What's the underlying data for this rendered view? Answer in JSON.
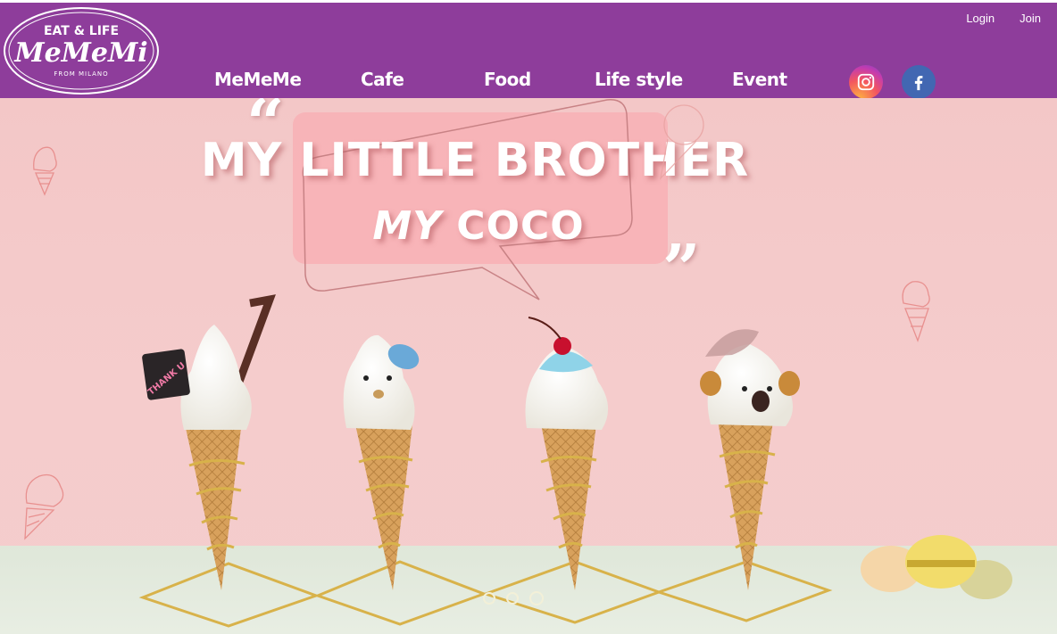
{
  "brand": {
    "tagline_top": "EAT & LIFE",
    "name": "MeMeMi",
    "tagline_bottom": "FROM MILANO"
  },
  "utility_nav": [
    {
      "label": "Login"
    },
    {
      "label": "Join"
    }
  ],
  "main_nav": [
    {
      "label": "MeMeMe"
    },
    {
      "label": "Cafe"
    },
    {
      "label": "Food"
    },
    {
      "label": "Life style"
    },
    {
      "label": "Event"
    }
  ],
  "social": [
    {
      "icon": "instagram-icon"
    },
    {
      "icon": "facebook-icon"
    }
  ],
  "hero": {
    "line1": "MY LITTLE BROTHER",
    "line2_a": "MY",
    "line2_b": "COCO",
    "open_quote": "“",
    "close_quote": "”",
    "slides_total": 3,
    "active_slide": 3,
    "sign_text": "THANK U"
  },
  "colors": {
    "header_bg": "#8e3d9b",
    "hero_bg": "#f3c7c7",
    "table_bg": "#dfe7d9",
    "bubble": "#f7b2b6"
  }
}
